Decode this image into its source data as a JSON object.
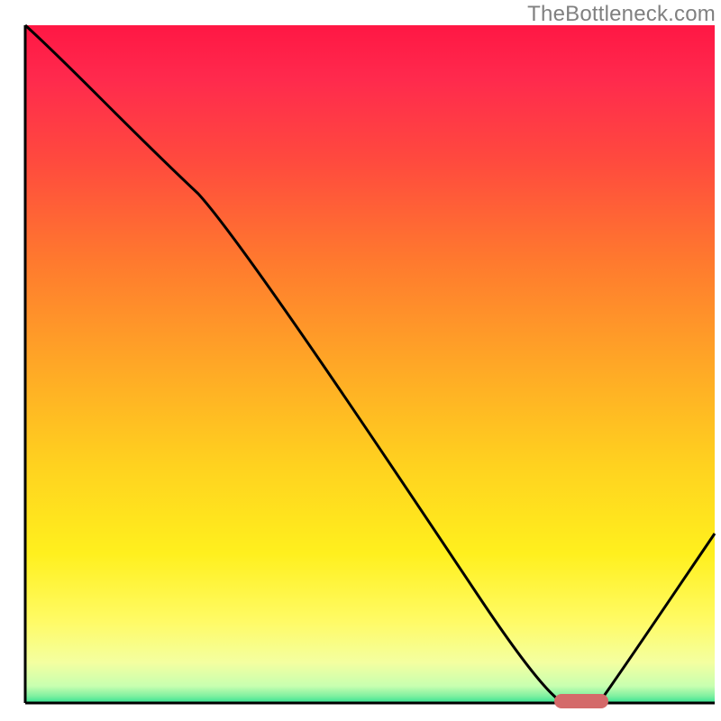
{
  "watermark": {
    "text": "TheBottleneck.com"
  },
  "chart_data": {
    "type": "line",
    "title": "",
    "xlabel": "",
    "ylabel": "",
    "xlim": [
      0,
      100
    ],
    "ylim": [
      0,
      100
    ],
    "x": [
      0,
      12,
      25,
      37,
      50,
      62,
      70,
      75,
      80,
      82,
      84,
      88,
      94,
      100
    ],
    "values": [
      100,
      89,
      75,
      58,
      42,
      25,
      12,
      4,
      0,
      0,
      0,
      6,
      15,
      25
    ],
    "series": [
      {
        "name": "bottleneck-curve",
        "x": [
          0,
          12,
          25,
          37,
          50,
          62,
          70,
          75,
          80,
          82,
          84,
          88,
          94,
          100
        ],
        "values": [
          100,
          89,
          75,
          58,
          42,
          25,
          12,
          4,
          0,
          0,
          0,
          6,
          15,
          25
        ]
      }
    ],
    "optimal_band": {
      "x_start": 77,
      "x_end": 85,
      "y": 0
    },
    "background_gradient": {
      "stops": [
        {
          "offset": 0,
          "color": "#ff1744"
        },
        {
          "offset": 0.08,
          "color": "#ff2a4d"
        },
        {
          "offset": 0.2,
          "color": "#ff4a3e"
        },
        {
          "offset": 0.35,
          "color": "#ff7a2e"
        },
        {
          "offset": 0.5,
          "color": "#ffa726"
        },
        {
          "offset": 0.65,
          "color": "#ffd21f"
        },
        {
          "offset": 0.78,
          "color": "#fff01e"
        },
        {
          "offset": 0.88,
          "color": "#fffb66"
        },
        {
          "offset": 0.94,
          "color": "#f4ffa0"
        },
        {
          "offset": 0.975,
          "color": "#c8ffb0"
        },
        {
          "offset": 0.99,
          "color": "#7ef0a0"
        },
        {
          "offset": 1.0,
          "color": "#30e090"
        }
      ]
    },
    "axis_color": "#000000",
    "curve_color": "#000000",
    "optimal_color": "#d46a6a"
  }
}
